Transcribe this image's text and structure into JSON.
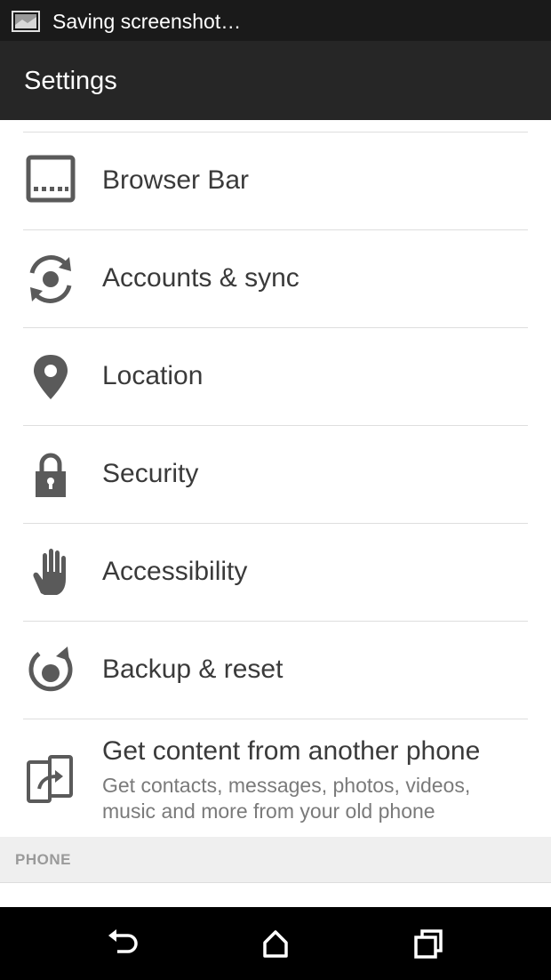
{
  "status_bar": {
    "notification_text": "Saving screenshot…",
    "icon": "screenshot-icon"
  },
  "action_bar": {
    "title": "Settings"
  },
  "settings": {
    "items": [
      {
        "label": "Browser Bar",
        "icon": "browser-bar-icon"
      },
      {
        "label": "Accounts & sync",
        "icon": "sync-icon"
      },
      {
        "label": "Location",
        "icon": "location-pin-icon"
      },
      {
        "label": "Security",
        "icon": "lock-icon"
      },
      {
        "label": "Accessibility",
        "icon": "hand-icon"
      },
      {
        "label": "Backup & reset",
        "icon": "backup-icon"
      },
      {
        "label": "Get content from another phone",
        "subtitle": "Get contacts, messages, photos, videos, music and more from your old phone",
        "icon": "phone-transfer-icon"
      }
    ]
  },
  "section": {
    "label": "PHONE"
  },
  "nav_bar": {
    "buttons": [
      "back-icon",
      "home-icon",
      "recent-apps-icon"
    ]
  },
  "colors": {
    "status_bar_bg": "#1a1a1a",
    "action_bar_bg": "#262626",
    "icon_gray": "#5a5a5a",
    "text_primary": "#3a3a3a",
    "text_secondary": "#7a7a7a",
    "section_bg": "#efefef"
  }
}
